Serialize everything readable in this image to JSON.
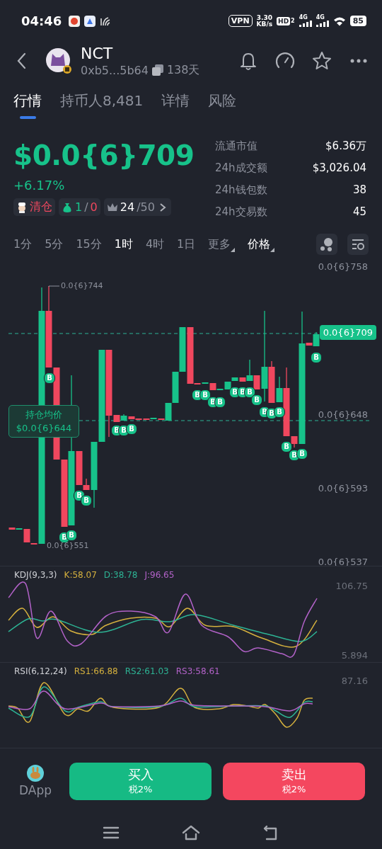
{
  "status_bar": {
    "time": "04:46",
    "vpn": "VPN",
    "speed": "3.30",
    "speed_unit": "KB/s",
    "hd": "HD",
    "hd_sub": "2",
    "networks": [
      "4G",
      "4G"
    ],
    "battery": "85"
  },
  "token": {
    "symbol": "NCT",
    "address": "0xb5...5b64",
    "age": "138天"
  },
  "tabs": [
    {
      "label": "行情",
      "selected": true
    },
    {
      "label": "持币人8,481",
      "selected": false
    },
    {
      "label": "详情",
      "selected": false
    },
    {
      "label": "风险",
      "selected": false
    }
  ],
  "price": {
    "value": "$0.0{6}709",
    "change": "+6.17%"
  },
  "badges": {
    "clear": "清仓",
    "buy_count": "1",
    "sep": "/",
    "sell_count": "0",
    "rank": "24",
    "rank_total": "/50"
  },
  "stats": [
    {
      "label": "流通市值",
      "value": "$6.36万"
    },
    {
      "label": "24h成交额",
      "value": "$3,026.04"
    },
    {
      "label": "24h钱包数",
      "value": "38"
    },
    {
      "label": "24h交易数",
      "value": "45"
    }
  ],
  "intervals": [
    {
      "label": "1分",
      "selected": false
    },
    {
      "label": "5分",
      "selected": false
    },
    {
      "label": "15分",
      "selected": false
    },
    {
      "label": "1时",
      "selected": true
    },
    {
      "label": "4时",
      "selected": false
    },
    {
      "label": "1日",
      "selected": false
    }
  ],
  "more": "更多",
  "mode": "价格",
  "chart": {
    "y_labels": [
      "0.0{6}758",
      "0.0{6}648",
      "0.0{6}593",
      "0.0{6}537"
    ],
    "high_label": "0.0{6}744",
    "low_label": "0.0{6}551",
    "current_price": "0.0{6}709",
    "avg_cost_title": "持仓均价",
    "avg_cost": "$0.0{6}644",
    "markers": [
      "B",
      "B",
      "B",
      "B",
      "B",
      "B",
      "B",
      "B",
      "B",
      "B",
      "B",
      "B",
      "B",
      "B",
      "B",
      "B",
      "B",
      "B",
      "B",
      "B",
      "B",
      "B",
      "B"
    ]
  },
  "kdj": {
    "name": "KDJ(9,3,3)",
    "values": [
      {
        "label": "K:58.07",
        "color": "#d4b03e"
      },
      {
        "label": "D:38.78",
        "color": "#2db394"
      },
      {
        "label": "J:96.65",
        "color": "#b262c8"
      }
    ],
    "max": "106.75",
    "min": "5.894"
  },
  "rsi": {
    "name": "RSI(6,12,24)",
    "values": [
      {
        "label": "RS1:66.88",
        "color": "#d4b03e"
      },
      {
        "label": "RS2:61.03",
        "color": "#2db394"
      },
      {
        "label": "RS3:58.61",
        "color": "#b262c8"
      }
    ],
    "max": "87.16"
  },
  "actions": {
    "dapp": "DApp",
    "buy": {
      "label": "买入",
      "tax": "税2%"
    },
    "sell": {
      "label": "卖出",
      "tax": "税2%"
    }
  }
}
